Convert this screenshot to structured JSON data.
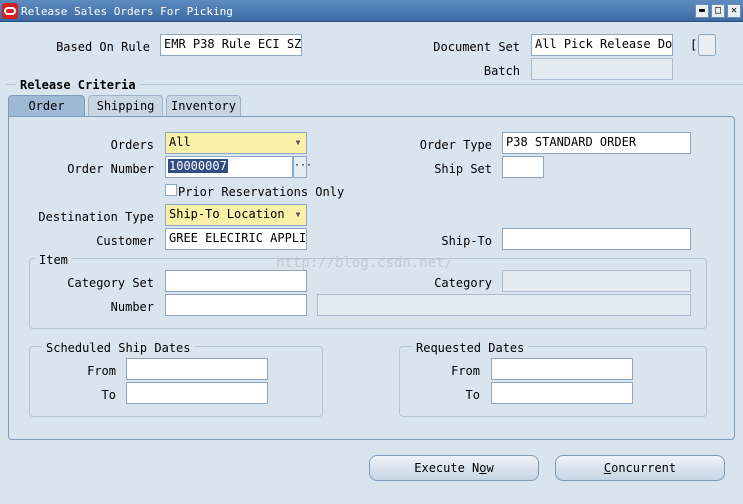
{
  "window": {
    "title": "Release Sales Orders For Picking",
    "minimize_glyph": "▬",
    "maximize_glyph": "□",
    "close_glyph": "✕"
  },
  "header": {
    "based_on_rule_label": "Based On Rule",
    "based_on_rule_value": "EMR P38 Rule ECI SZ",
    "document_set_label": "Document Set",
    "document_set_value": "All Pick Release Doc",
    "bracket_open": "[",
    "batch_label": "Batch",
    "batch_value": ""
  },
  "release_criteria": {
    "title": "Release Criteria",
    "tabs": [
      {
        "label": "Order",
        "active": true
      },
      {
        "label": "Shipping",
        "active": false
      },
      {
        "label": "Inventory",
        "active": false
      }
    ]
  },
  "order_tab": {
    "orders_label": "Orders",
    "orders_value": "All",
    "order_type_label": "Order Type",
    "order_type_value": "P38 STANDARD ORDER",
    "order_number_label": "Order Number",
    "order_number_value": "10000007",
    "lov_glyph": "···",
    "ship_set_label": "Ship Set",
    "ship_set_value": "",
    "prior_reservations_label": "Prior Reservations Only",
    "destination_type_label": "Destination Type",
    "destination_type_value": "Ship-To Location",
    "customer_label": "Customer",
    "customer_value": "GREE ELECIRIC APPLIA",
    "ship_to_label": "Ship-To",
    "ship_to_value": "",
    "dropdown_glyph": "▼"
  },
  "item": {
    "title": "Item",
    "category_set_label": "Category Set",
    "category_label": "Category",
    "number_label": "Number"
  },
  "scheduled_ship_dates": {
    "title": "Scheduled Ship Dates",
    "from_label": "From",
    "to_label": "To"
  },
  "requested_dates": {
    "title": "Requested Dates",
    "from_label": "From",
    "to_label": "To"
  },
  "watermark": "http://blog.csdn.net/",
  "buttons": {
    "execute_now_pre": "Execute N",
    "execute_now_u": "o",
    "execute_now_post": "w",
    "concurrent_u": "C",
    "concurrent_post": "oncurrent"
  }
}
